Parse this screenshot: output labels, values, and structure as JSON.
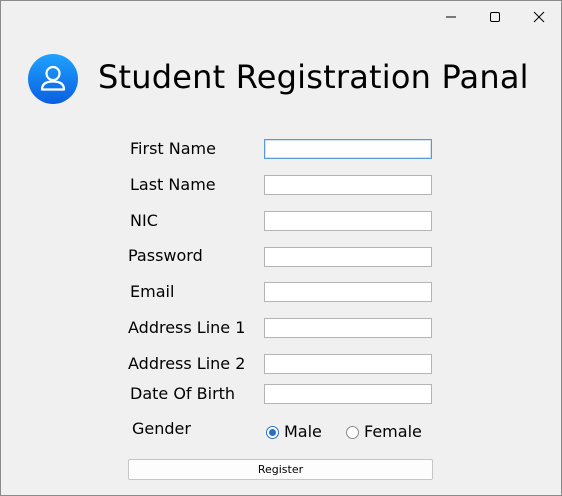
{
  "window": {
    "controls": [
      "minimize-icon",
      "maximize-icon",
      "close-icon"
    ]
  },
  "header": {
    "icon": "user-icon",
    "title": "Student Registration Panal",
    "icon_gradient": [
      "#1fa2ff",
      "#0a5fe0"
    ]
  },
  "form": {
    "first_name": {
      "label": "First Name",
      "value": ""
    },
    "last_name": {
      "label": "Last Name",
      "value": ""
    },
    "nic": {
      "label": "NIC",
      "value": ""
    },
    "password": {
      "label": "Password",
      "value": ""
    },
    "email": {
      "label": "Email",
      "value": ""
    },
    "address_line_1": {
      "label": "Address Line 1",
      "value": ""
    },
    "address_line_2": {
      "label": "Address Line 2",
      "value": ""
    },
    "date_of_birth": {
      "label": "Date Of Birth",
      "value": ""
    },
    "gender": {
      "label": "Gender",
      "options": [
        "Male",
        "Female"
      ],
      "selected": "Male"
    },
    "register_label": "Register"
  },
  "colors": {
    "window_background": "#f0f0f0",
    "focus_border": "#5a9bd5",
    "radio_accent": "#2b6fc4"
  }
}
